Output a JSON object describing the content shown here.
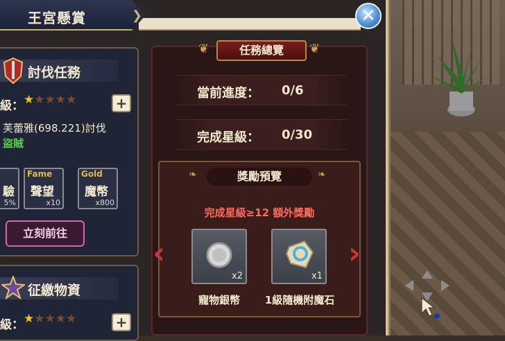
{
  "window": {
    "title": "王宮懸賞"
  },
  "card1": {
    "title": "討伐任務",
    "level_label": "級：",
    "stars_filled": 1,
    "stars_total": 5,
    "target_text": "芙蕾雅(698.221)討伐",
    "target_enemy": "盜賊",
    "rewards": [
      {
        "tag": "",
        "label": "驗",
        "count": "5%"
      },
      {
        "tag": "Fame",
        "label": "聲望",
        "count": "x10"
      },
      {
        "tag": "Gold",
        "label": "魔幣",
        "count": "x800"
      }
    ],
    "go_button": "立刻前往"
  },
  "card2": {
    "title": "征繳物資",
    "level_label": "級：",
    "stars_filled": 1,
    "stars_total": 5
  },
  "panel": {
    "title": "任務總覽",
    "progress_label": "當前進度：",
    "progress_value": "0/6",
    "stars_label": "完成星級：",
    "stars_value": "0/30",
    "reward_title": "獎勵預覽",
    "bonus_text": "完成星級≥12 額外獎勵",
    "items": [
      {
        "name": "寵物銀幣",
        "count": "x2",
        "icon": "silver-coin-icon"
      },
      {
        "name": "1級隨機附魔石",
        "count": "x1",
        "icon": "enchant-stone-icon"
      }
    ]
  },
  "colors": {
    "accent_red": "#c9323a",
    "gold": "#c9a050",
    "text_light": "#f3e9d0",
    "bonus_red": "#ff6a5a"
  }
}
